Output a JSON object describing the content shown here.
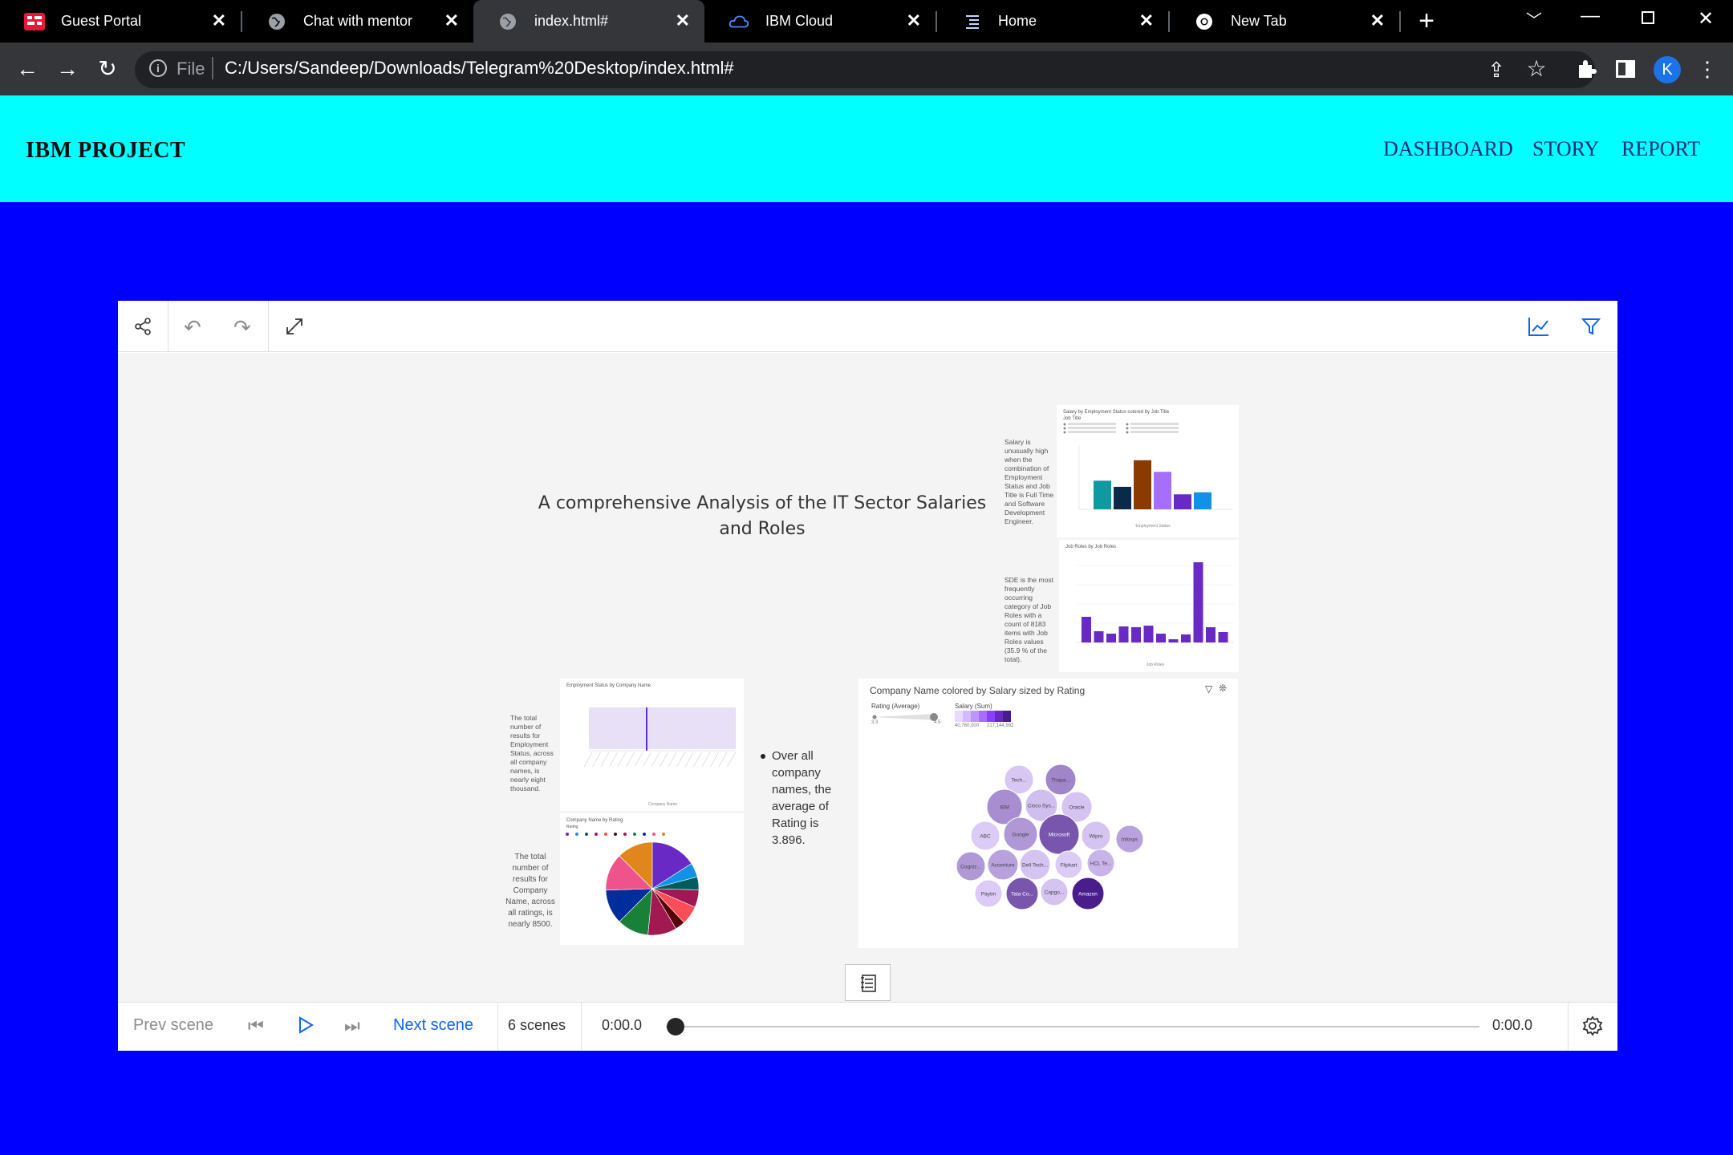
{
  "tabs": [
    {
      "label": "Guest Portal",
      "icon": "guest-portal-icon"
    },
    {
      "label": "Chat with mentor",
      "icon": "globe-icon"
    },
    {
      "label": "index.html#",
      "icon": "globe-icon",
      "active": true
    },
    {
      "label": "IBM Cloud",
      "icon": "ibm-cloud-icon"
    },
    {
      "label": "Home",
      "icon": "home-lines-icon"
    },
    {
      "label": "New Tab",
      "icon": "chrome-icon"
    }
  ],
  "address": {
    "scheme_label": "File",
    "url": "C:/Users/Sandeep/Downloads/Telegram%20Desktop/index.html#"
  },
  "profile": {
    "initial": "K",
    "color": "#1a73e8"
  },
  "site": {
    "brand": "IBM PROJECT",
    "nav": [
      "DASHBOARD",
      "STORY",
      "REPORT"
    ],
    "header_color": "#00ffff",
    "background_color": "#0000ff"
  },
  "story": {
    "title": "A comprehensive Analysis of the IT Sector Salaries and Roles",
    "notes": {
      "salary_high": "Salary is unusually high when the combination of Employment Status and Job Title is Full Time and Software Development Engineer.",
      "sde_most": "SDE is the most frequently occurring category of Job Roles with a count of 8183 items with Job Roles values (35.9 % of the total).",
      "employment_total": "The total number of results for Employment Status, across all company names, is nearly eight thousand.",
      "rating_avg": "Over all company names, the average of Rating is 3.896.",
      "company_total": "The total number of results for Company Name, across all ratings, is nearly 8500."
    },
    "widgets": {
      "salary_by_status": {
        "title": "Salary by Employment Status colored by Job Title",
        "legend_title": "Job Title",
        "xlabel": "Employment Status"
      },
      "job_roles": {
        "title": "Job Roles by Job Roles",
        "xlabel": "Job Roles"
      },
      "employment_by_company": {
        "title": "Employment Status by Company Name",
        "xlabel": "Company Name"
      },
      "company_by_rating": {
        "title": "Company Name by Rating",
        "legend_title": "Rating"
      },
      "bubble": {
        "title": "Company Name colored by Salary sized by Rating",
        "legend_rating": "Rating (Average)",
        "legend_salary": "Salary (Sum)",
        "rating_min": "3.3",
        "rating_max": "4.5",
        "salary_min": "40,760,000",
        "salary_max": "217,144,992"
      }
    }
  },
  "player": {
    "prev": "Prev scene",
    "next": "Next scene",
    "scenes": "6 scenes",
    "time_start": "0:00.0",
    "time_end": "0:00.0",
    "progress": 0
  },
  "chart_data": [
    {
      "type": "bar",
      "title": "Salary by Employment Status colored by Job Title",
      "xlabel": "Employment Status",
      "series_colors": [
        "#0e9aa0",
        "#0b2a4a",
        "#8a3b00",
        "#a56eff",
        "#6929c4",
        "#1192e8"
      ],
      "values": [
        0.42,
        0.33,
        0.72,
        0.55,
        0.22,
        0.25
      ]
    },
    {
      "type": "bar",
      "title": "Job Roles by Job Roles",
      "xlabel": "Job Roles",
      "values": [
        0.32,
        0.14,
        0.11,
        0.2,
        0.19,
        0.21,
        0.11,
        0.04,
        0.1,
        1.0,
        0.19,
        0.13
      ]
    },
    {
      "type": "pie",
      "title": "Company Name by Rating",
      "slices": [
        {
          "value": 15.9,
          "color": "#6929c4"
        },
        {
          "value": 5.0,
          "color": "#1192e8"
        },
        {
          "value": 4.5,
          "color": "#005d5d"
        },
        {
          "value": 6.1,
          "color": "#9f1853"
        },
        {
          "value": 6.5,
          "color": "#fa4d56"
        },
        {
          "value": 3.5,
          "color": "#570408"
        },
        {
          "value": 10.0,
          "color": "#a11950"
        },
        {
          "value": 11.0,
          "color": "#198038"
        },
        {
          "value": 12.0,
          "color": "#002d9c"
        },
        {
          "value": 13.0,
          "color": "#ee538b"
        },
        {
          "value": 12.5,
          "color": "#e0861c"
        }
      ]
    },
    {
      "type": "scatter",
      "title": "Company Name colored by Salary sized by Rating",
      "points": [
        {
          "name": "Tech...",
          "shade": 0.1
        },
        {
          "name": "Thapa...",
          "shade": 0.45
        },
        {
          "name": "IBM",
          "shade": 0.4
        },
        {
          "name": "Cisco Sys...",
          "shade": 0.15
        },
        {
          "name": "Oracle",
          "shade": 0.12
        },
        {
          "name": "ABC",
          "shade": 0.08
        },
        {
          "name": "Google",
          "shade": 0.35
        },
        {
          "name": "Microsoft",
          "shade": 0.7
        },
        {
          "name": "Wipro",
          "shade": 0.12
        },
        {
          "name": "Infosys",
          "shade": 0.3
        },
        {
          "name": "Cogniz...",
          "shade": 0.35
        },
        {
          "name": "Accenture",
          "shade": 0.3
        },
        {
          "name": "Dell Tech...",
          "shade": 0.12
        },
        {
          "name": "Flipkart",
          "shade": 0.08
        },
        {
          "name": "HCL Te...",
          "shade": 0.2
        },
        {
          "name": "Paytm",
          "shade": 0.08
        },
        {
          "name": "Tata Co...",
          "shade": 0.7
        },
        {
          "name": "Capgo...",
          "shade": 0.12
        },
        {
          "name": "Amazon",
          "shade": 1.0
        }
      ]
    }
  ]
}
